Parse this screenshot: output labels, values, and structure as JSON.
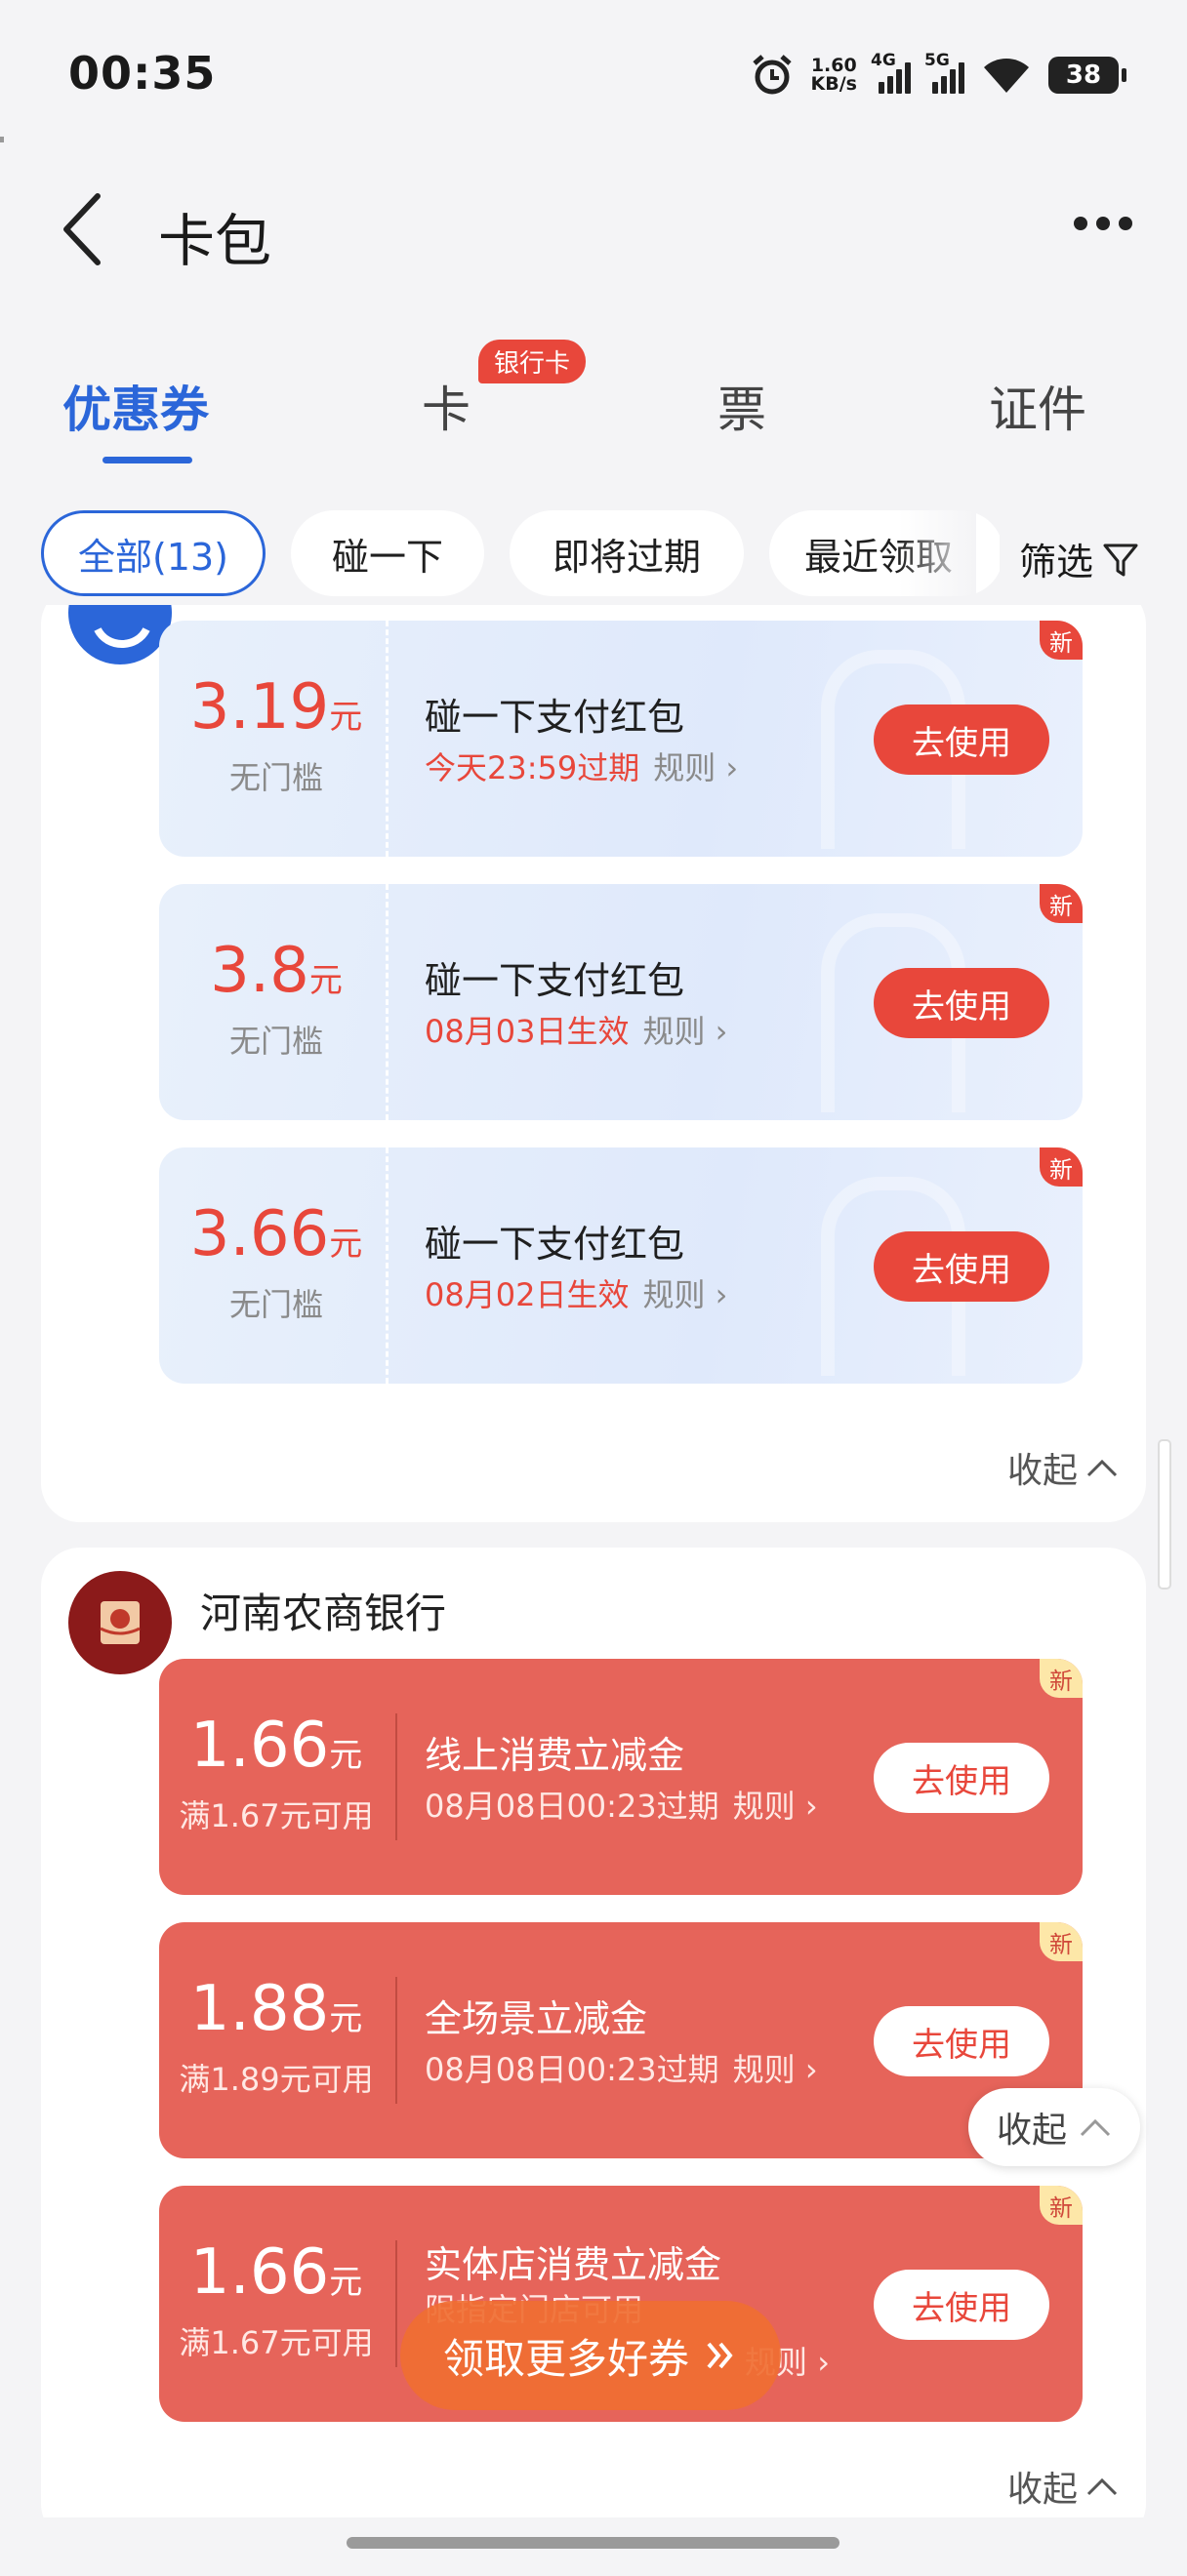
{
  "status_bar": {
    "time": "00:35",
    "net_speed_value": "1.60",
    "net_speed_unit": "KB/s",
    "sig1": "4G",
    "sig2": "5G",
    "battery": "38"
  },
  "header": {
    "title": "卡包"
  },
  "tabs": [
    {
      "label": "优惠券",
      "active": true
    },
    {
      "label": "卡",
      "badge": "银行卡"
    },
    {
      "label": "票"
    },
    {
      "label": "证件"
    }
  ],
  "chips": [
    {
      "label": "全部(13)",
      "active": true
    },
    {
      "label": "碰一下"
    },
    {
      "label": "即将过期"
    },
    {
      "label": "最近领取"
    }
  ],
  "filter_label": "筛选",
  "group1": {
    "coupons": [
      {
        "amount": "3.19",
        "unit": "元",
        "condition": "无门槛",
        "title": "碰一下支付红包",
        "expiry": "今天23:59过期",
        "rule": "规则",
        "button": "去使用",
        "tag": "新"
      },
      {
        "amount": "3.8",
        "unit": "元",
        "condition": "无门槛",
        "title": "碰一下支付红包",
        "expiry": "08月03日生效",
        "rule": "规则",
        "button": "去使用",
        "tag": "新"
      },
      {
        "amount": "3.66",
        "unit": "元",
        "condition": "无门槛",
        "title": "碰一下支付红包",
        "expiry": "08月02日生效",
        "rule": "规则",
        "button": "去使用",
        "tag": "新"
      }
    ],
    "collapse": "收起"
  },
  "group2": {
    "bank_name": "河南农商银行",
    "coupons": [
      {
        "amount": "1.66",
        "unit": "元",
        "condition": "满1.67元可用",
        "title": "线上消费立减金",
        "expiry": "08月08日00:23过期",
        "rule": "规则",
        "button": "去使用",
        "tag": "新"
      },
      {
        "amount": "1.88",
        "unit": "元",
        "condition": "满1.89元可用",
        "title": "全场景立减金",
        "expiry": "08月08日00:23过期",
        "rule": "规则",
        "button": "去使用",
        "tag": "新"
      },
      {
        "amount": "1.66",
        "unit": "元",
        "condition": "满1.67元可用",
        "title": "实体店消费立减金",
        "expiry": "限指定门店可用",
        "rule": "规则",
        "button": "去使用",
        "tag": "新"
      }
    ],
    "collapse": "收起"
  },
  "float_collapse": "收起",
  "more_coupons": "领取更多好券"
}
